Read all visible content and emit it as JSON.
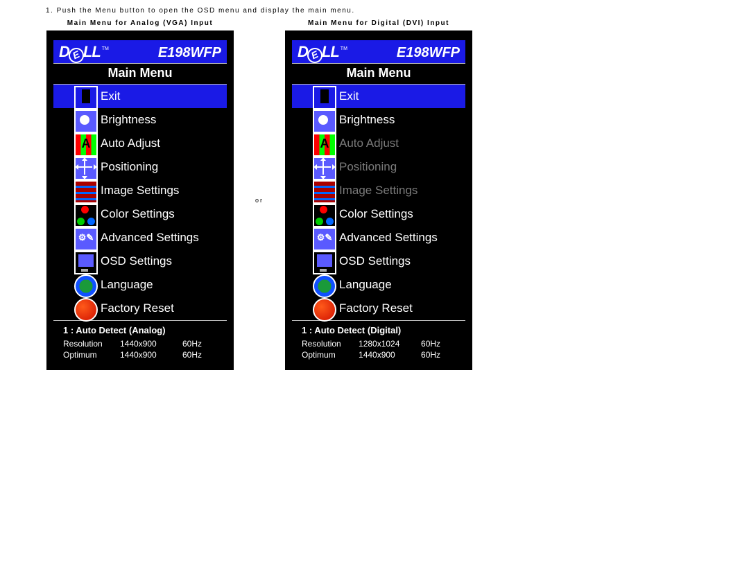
{
  "instruction_num": "1.",
  "instruction_text": "Push the Menu button to open the OSD menu and display the main menu.",
  "separator_word": "or",
  "panels": [
    {
      "caption": "Main Menu for Analog (VGA) Input",
      "brand": "DELL",
      "tm": "TM",
      "model": "E198WFP",
      "title": "Main Menu",
      "items": [
        {
          "label": "Exit",
          "icon": "exit",
          "selected": true,
          "disabled": false
        },
        {
          "label": "Brightness",
          "icon": "bright",
          "selected": false,
          "disabled": false
        },
        {
          "label": "Auto Adjust",
          "icon": "auto",
          "selected": false,
          "disabled": false
        },
        {
          "label": "Positioning",
          "icon": "pos",
          "selected": false,
          "disabled": false
        },
        {
          "label": "Image Settings",
          "icon": "img",
          "selected": false,
          "disabled": false
        },
        {
          "label": "Color Settings",
          "icon": "color",
          "selected": false,
          "disabled": false
        },
        {
          "label": "Advanced Settings",
          "icon": "adv",
          "selected": false,
          "disabled": false
        },
        {
          "label": "OSD Settings",
          "icon": "osd",
          "selected": false,
          "disabled": false
        },
        {
          "label": "Language",
          "icon": "lang",
          "selected": false,
          "disabled": false
        },
        {
          "label": "Factory Reset",
          "icon": "reset",
          "selected": false,
          "disabled": false
        }
      ],
      "status": {
        "mode": "1 : Auto Detect (Analog)",
        "rows": [
          {
            "k": "Resolution",
            "v": "1440x900",
            "hz": "60Hz"
          },
          {
            "k": "Optimum",
            "v": "1440x900",
            "hz": "60Hz"
          }
        ]
      }
    },
    {
      "caption": "Main Menu for Digital (DVI) Input",
      "brand": "DELL",
      "tm": "TM",
      "model": "E198WFP",
      "title": "Main Menu",
      "items": [
        {
          "label": "Exit",
          "icon": "exit",
          "selected": true,
          "disabled": false
        },
        {
          "label": "Brightness",
          "icon": "bright",
          "selected": false,
          "disabled": false
        },
        {
          "label": "Auto Adjust",
          "icon": "auto",
          "selected": false,
          "disabled": true
        },
        {
          "label": "Positioning",
          "icon": "pos",
          "selected": false,
          "disabled": true
        },
        {
          "label": "Image Settings",
          "icon": "img",
          "selected": false,
          "disabled": true
        },
        {
          "label": "Color Settings",
          "icon": "color",
          "selected": false,
          "disabled": false
        },
        {
          "label": "Advanced Settings",
          "icon": "adv",
          "selected": false,
          "disabled": false
        },
        {
          "label": "OSD Settings",
          "icon": "osd",
          "selected": false,
          "disabled": false
        },
        {
          "label": "Language",
          "icon": "lang",
          "selected": false,
          "disabled": false
        },
        {
          "label": "Factory Reset",
          "icon": "reset",
          "selected": false,
          "disabled": false
        }
      ],
      "status": {
        "mode": "1 : Auto Detect (Digital)",
        "rows": [
          {
            "k": "Resolution",
            "v": "1280x1024",
            "hz": "60Hz"
          },
          {
            "k": "Optimum",
            "v": "1440x900",
            "hz": "60Hz"
          }
        ]
      }
    }
  ]
}
